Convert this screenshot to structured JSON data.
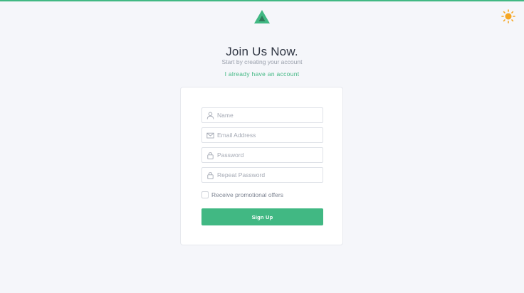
{
  "colors": {
    "accent": "#41b883",
    "logo_dark": "#2f7a5a",
    "sun": "#f5a623",
    "background": "#f5f6fa"
  },
  "header": {
    "logo_icon": "triangle-logo-icon",
    "theme_toggle_icon": "sun-icon"
  },
  "intro": {
    "title": "Join Us Now.",
    "subtitle": "Start by creating your account",
    "login_link": "I already have an account"
  },
  "form": {
    "name": {
      "placeholder": "Name",
      "value": "",
      "icon": "user-icon"
    },
    "email": {
      "placeholder": "Email Address",
      "value": "",
      "icon": "envelope-icon"
    },
    "password": {
      "placeholder": "Password",
      "value": "",
      "icon": "lock-icon"
    },
    "repeat_password": {
      "placeholder": "Repeat Password",
      "value": "",
      "icon": "lock-icon"
    },
    "promo_checkbox": {
      "label": "Receive promotional offers",
      "checked": false
    },
    "submit_label": "Sign Up"
  }
}
